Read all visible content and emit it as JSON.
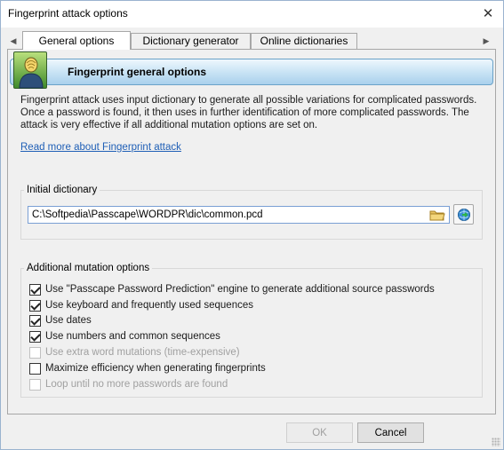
{
  "window": {
    "title": "Fingerprint attack options"
  },
  "tabs": [
    {
      "label": "General options",
      "active": true
    },
    {
      "label": "Dictionary generator",
      "active": false
    },
    {
      "label": "Online dictionaries",
      "active": false
    }
  ],
  "header": {
    "title": "Fingerprint general options",
    "icon": "fingerprint-user-icon"
  },
  "description": "Fingerprint attack uses input dictionary to generate all possible variations for complicated passwords. Once a password is found, it then uses in further identification of more complicated passwords. The attack is very effective if all additional mutation options are set on.",
  "read_more_link": "Read more about Fingerprint attack",
  "initial_dictionary": {
    "label": "Initial dictionary",
    "path": "C:\\Softpedia\\Passcape\\WORDPR\\dic\\common.pcd"
  },
  "mutation": {
    "label": "Additional mutation options",
    "options": [
      {
        "label": "Use \"Passcape Password Prediction\" engine to generate additional source passwords",
        "checked": true,
        "enabled": true
      },
      {
        "label": "Use keyboard and frequently used sequences",
        "checked": true,
        "enabled": true
      },
      {
        "label": "Use dates",
        "checked": true,
        "enabled": true
      },
      {
        "label": "Use numbers and common sequences",
        "checked": true,
        "enabled": true
      },
      {
        "label": "Use extra word mutations (time-expensive)",
        "checked": false,
        "enabled": false
      },
      {
        "label": "Maximize efficiency when generating fingerprints",
        "checked": false,
        "enabled": true
      },
      {
        "label": "Loop until no more passwords are found",
        "checked": false,
        "enabled": false
      }
    ]
  },
  "buttons": {
    "ok": "OK",
    "cancel": "Cancel"
  },
  "colors": {
    "accent": "#1f5fb6",
    "header_gradient_bottom": "#a9d0ec",
    "input_border": "#7a9fd4"
  }
}
